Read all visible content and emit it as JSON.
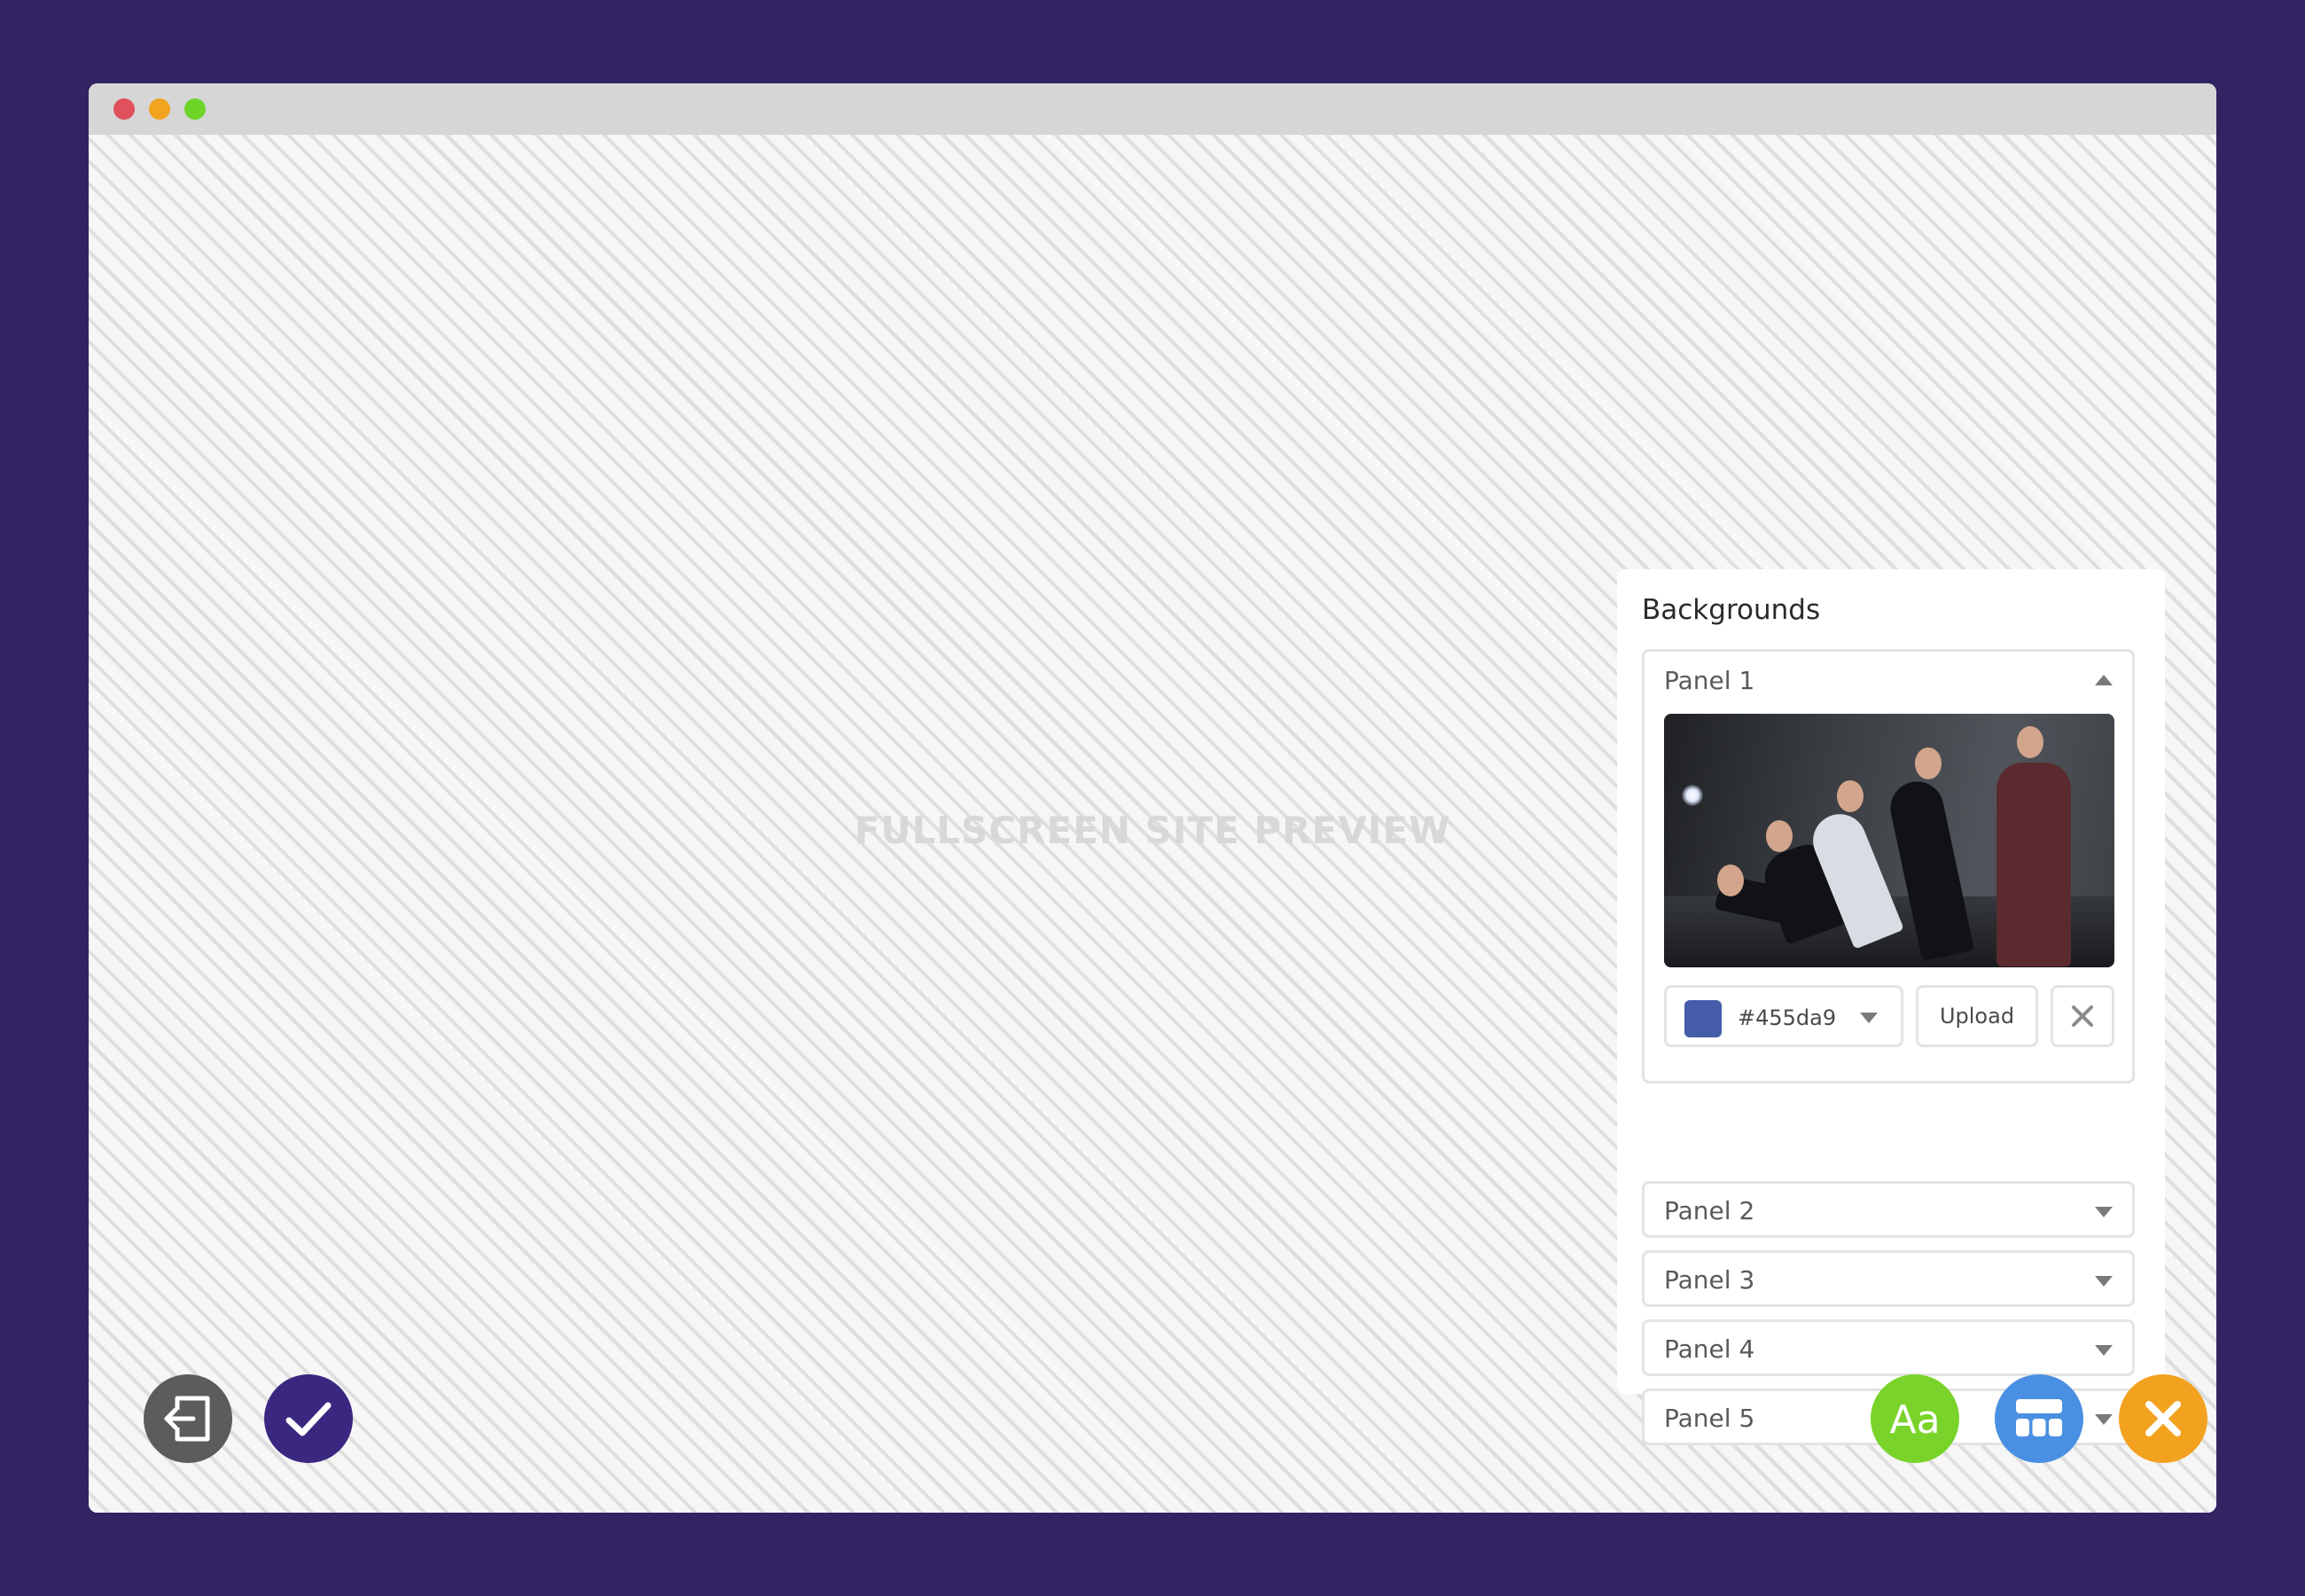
{
  "window": {
    "traffic_lights": [
      "close",
      "minimize",
      "maximize"
    ]
  },
  "preview": {
    "label": "FULLSCREEN SITE PREVIEW"
  },
  "backgrounds_panel": {
    "title": "Backgrounds",
    "panels": [
      {
        "label": "Panel 1",
        "expanded": true,
        "color_value": "#455da9",
        "swatch_color": "#455da9",
        "upload_label": "Upload"
      },
      {
        "label": "Panel 2",
        "expanded": false
      },
      {
        "label": "Panel 3",
        "expanded": false
      },
      {
        "label": "Panel 4",
        "expanded": false
      },
      {
        "label": "Panel 5",
        "expanded": false
      }
    ]
  },
  "actions": {
    "exit_icon": "exit-icon",
    "confirm_icon": "check-icon",
    "typography_label": "Aa",
    "typography_color": "#7ad32a",
    "layout_icon": "layout-icon",
    "layout_color": "#4a90e2",
    "close_icon": "close-icon",
    "close_color": "#f3a21f",
    "exit_color": "#5c5c5c",
    "confirm_color": "#3a2880"
  }
}
